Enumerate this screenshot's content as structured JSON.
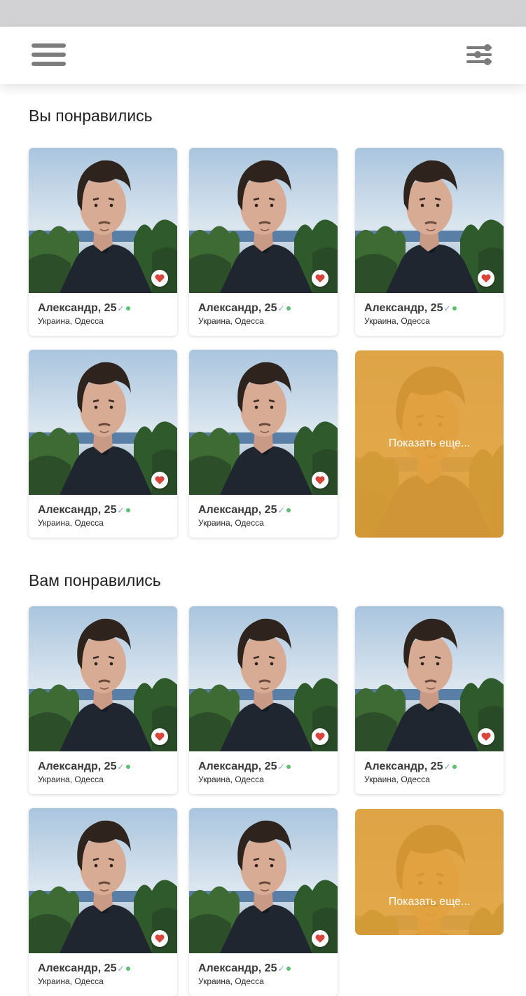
{
  "header": {
    "menu_icon": "hamburger-menu-icon",
    "filter_icon": "filter-sliders-icon"
  },
  "colors": {
    "status_bar": "#d2d2d4",
    "accent_more_card": "#e3a138",
    "heart": "#d9443b",
    "online": "#5bc16c",
    "menu_icon": "#7c7c7c"
  },
  "sections": [
    {
      "title": "Вы понравились",
      "profiles": [
        {
          "name": "Александр, 25",
          "location": "Украина, Одесса"
        },
        {
          "name": "Александр, 25",
          "location": "Украина, Одесса"
        },
        {
          "name": "Александр, 25",
          "location": "Украина, Одесса"
        },
        {
          "name": "Александр, 25",
          "location": "Украина, Одесса"
        },
        {
          "name": "Александр, 25",
          "location": "Украина, Одесса"
        }
      ],
      "more_label": "Показать еще..."
    },
    {
      "title": "Вам понравились",
      "profiles": [
        {
          "name": "Александр, 25",
          "location": "Украина, Одесса"
        },
        {
          "name": "Александр, 25",
          "location": "Украина, Одесса"
        },
        {
          "name": "Александр, 25",
          "location": "Украина, Одесса"
        },
        {
          "name": "Александр, 25",
          "location": "Украина, Одесса"
        },
        {
          "name": "Александр, 25",
          "location": "Украина, Одесса"
        }
      ],
      "more_label": "Показать еще..."
    }
  ],
  "icons": {
    "verified": "checkmark-icon",
    "online": "online-dot-icon",
    "like": "heart-icon"
  }
}
